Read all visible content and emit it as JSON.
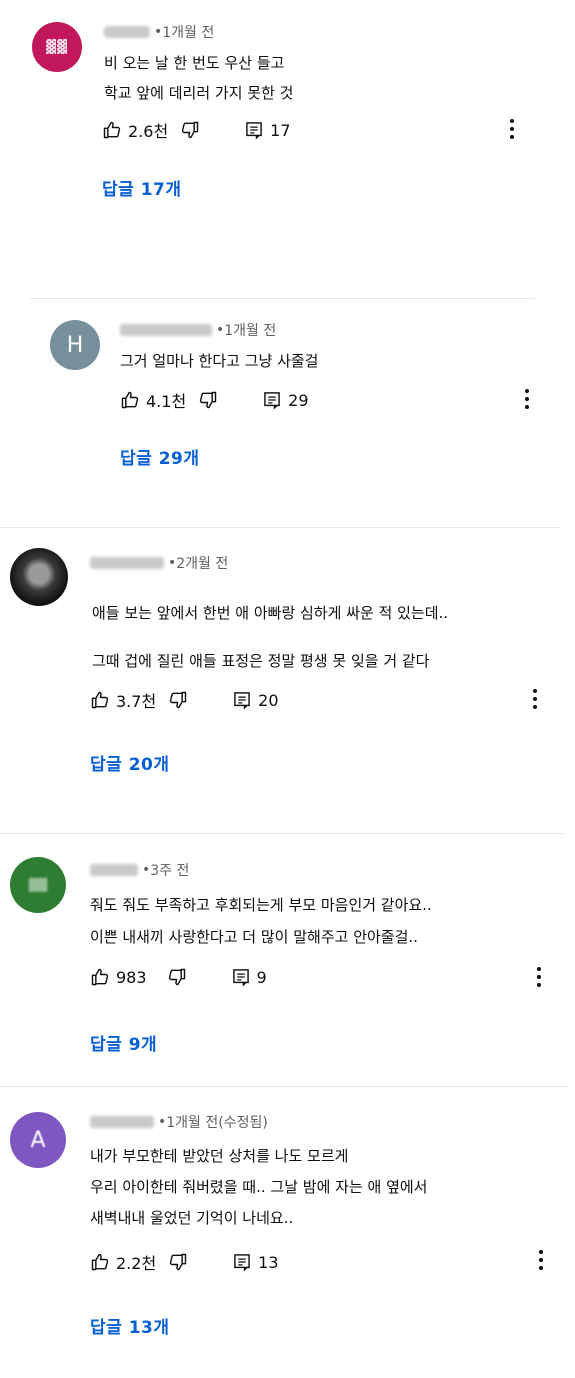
{
  "comments": [
    {
      "avatar_letter": "",
      "time": "1개월 전",
      "lines": [
        "비 오는 날 한 번도 우산 들고",
        "학교 앞에 데리러 가지 못한 것"
      ],
      "likes": "2.6천",
      "replies_count": "17",
      "replies_link": "답글 17개",
      "avatar_color": "#c2185b"
    },
    {
      "avatar_letter": "H",
      "time": "1개월 전",
      "lines": [
        "그거 얼마나 한다고 그냥 사줄걸"
      ],
      "likes": "4.1천",
      "replies_count": "29",
      "replies_link": "답글 29개",
      "avatar_color": "#78909c"
    },
    {
      "avatar_letter": "",
      "time": "2개월 전",
      "lines": [
        "애들 보는 앞에서 한번 애 아빠랑 심하게 싸운 적 있는데..",
        "그때 겁에 질린 애들 표정은 정말 평생 못 잊을 거 같다"
      ],
      "likes": "3.7천",
      "replies_count": "20",
      "replies_link": "답글 20개",
      "avatar_color": "#333333"
    },
    {
      "avatar_letter": "",
      "time": "3주 전",
      "lines": [
        "줘도 줘도 부족하고 후회되는게 부모 마음인거 같아요..",
        "이쁜 내새끼 사랑한다고 더 많이 말해주고 안아줄걸.."
      ],
      "likes": "983",
      "replies_count": "9",
      "replies_link": "답글 9개",
      "avatar_color": "#2e7d32"
    },
    {
      "avatar_letter": "A",
      "time": "1개월 전(수정됨)",
      "lines": [
        "내가 부모한테 받았던 상처를 나도 모르게",
        "우리 아이한테 줘버렸을 때.. 그날 밤에 자는 애 옆에서",
        "새벽내내 울었던 기억이 나네요.."
      ],
      "likes": "2.2천",
      "replies_count": "13",
      "replies_link": "답글 13개",
      "avatar_color": "#7e57c2"
    }
  ],
  "icons": {
    "like": "thumbs-up-icon",
    "dislike": "thumbs-down-icon",
    "reply": "reply-icon",
    "more": "more-vert-icon"
  },
  "colors": {
    "link": "#065fd4",
    "meta": "#606060",
    "text": "#0f0f0f",
    "divider": "#e5e5e5"
  }
}
